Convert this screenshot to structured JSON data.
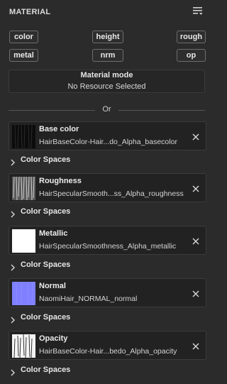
{
  "panel": {
    "title": "MATERIAL",
    "menu_icon": "filter-list-icon"
  },
  "channels": {
    "color": "color",
    "height": "height",
    "rough": "rough",
    "metal": "metal",
    "nrm": "nrm",
    "op": "op"
  },
  "material_mode": {
    "title": "Material mode",
    "value": "No Resource Selected"
  },
  "separator": {
    "text": "Or"
  },
  "color_spaces_label": "Color Spaces",
  "slots": [
    {
      "title": "Base color",
      "file": "HairBaseColor-Hair...do_Alpha_basecolor",
      "thumb": "dark-hair-texture"
    },
    {
      "title": "Roughness",
      "file": "HairSpecularSmooth...ss_Alpha_roughness",
      "thumb": "gray-hair-strands"
    },
    {
      "title": "Metallic",
      "file": "HairSpecularSmoothness_Alpha_metallic",
      "thumb": "white-solid"
    },
    {
      "title": "Normal",
      "file": "NaomiHair_NORMAL_normal",
      "thumb": "blue-normal-map",
      "thumb_color": "#7f80ff"
    },
    {
      "title": "Opacity",
      "file": "HairBaseColor-Hair...bedo_Alpha_opacity",
      "thumb": "white-hair-strands"
    }
  ]
}
